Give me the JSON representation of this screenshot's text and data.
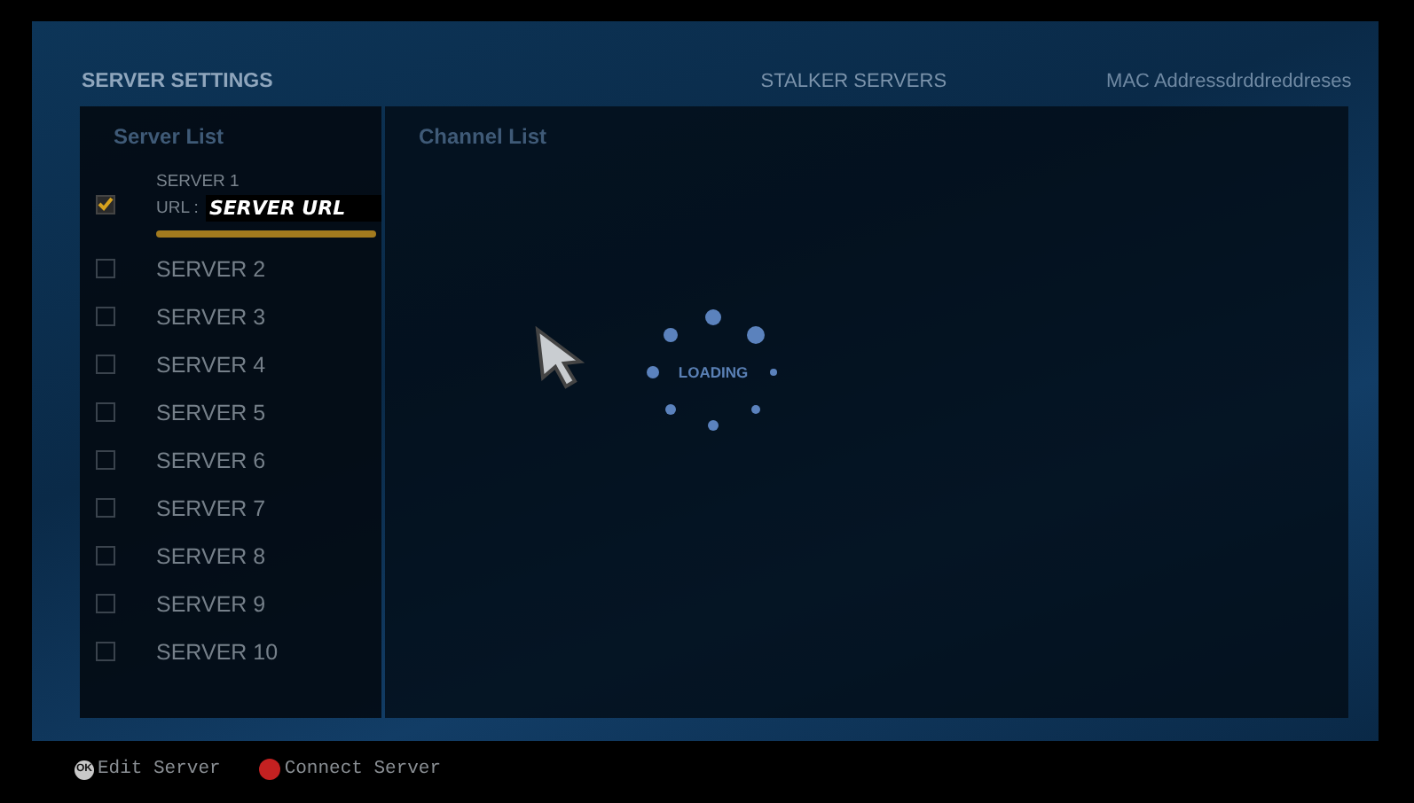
{
  "header": {
    "title": "SERVER SETTINGS",
    "section": "STALKER SERVERS",
    "mac": "MAC Addressdrddreddreses"
  },
  "server_list": {
    "title": "Server List",
    "servers": [
      {
        "name": "SERVER 1",
        "checked": true,
        "url_label": "URL :",
        "url": "SERVER URL"
      },
      {
        "name": "SERVER 2",
        "checked": false
      },
      {
        "name": "SERVER 3",
        "checked": false
      },
      {
        "name": "SERVER 4",
        "checked": false
      },
      {
        "name": "SERVER 5",
        "checked": false
      },
      {
        "name": "SERVER 6",
        "checked": false
      },
      {
        "name": "SERVER 7",
        "checked": false
      },
      {
        "name": "SERVER 8",
        "checked": false
      },
      {
        "name": "SERVER 9",
        "checked": false
      },
      {
        "name": "SERVER 10",
        "checked": false
      }
    ]
  },
  "channel_list": {
    "title": "Channel List",
    "loading_text": "LOADING"
  },
  "footer": [
    {
      "kind": "ok",
      "badge": "OK",
      "label": "Edit Server"
    },
    {
      "kind": "red",
      "label": "Connect Server"
    }
  ]
}
